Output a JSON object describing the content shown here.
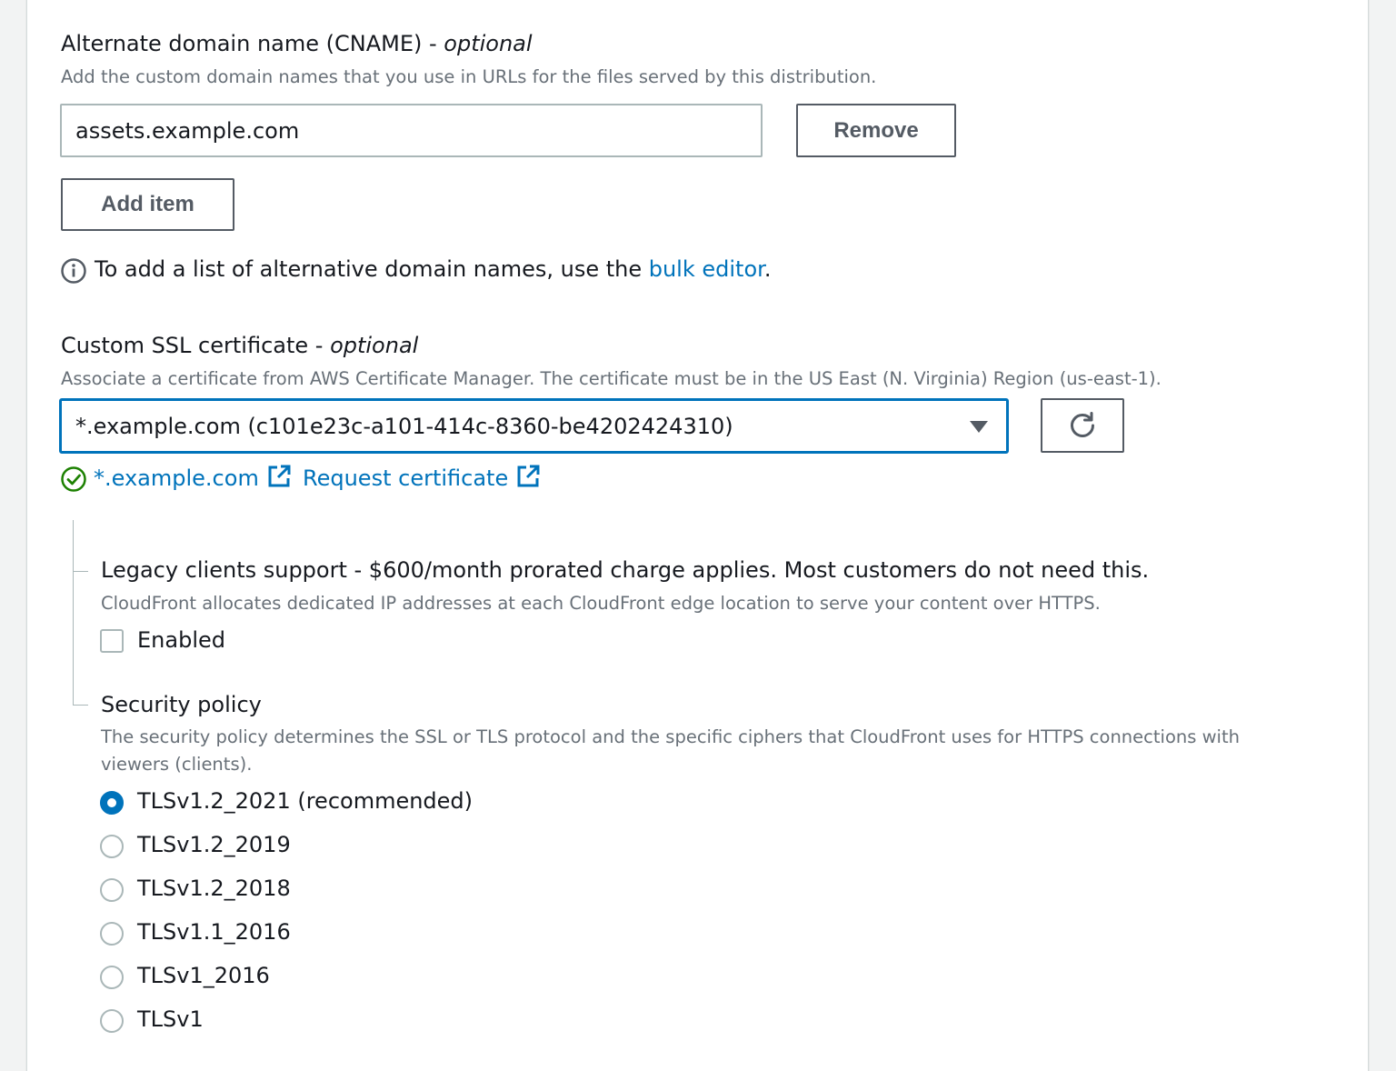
{
  "cname": {
    "label": "Alternate domain name (CNAME) - ",
    "label_optional": "optional",
    "description": "Add the custom domain names that you use in URLs for the files served by this distribution.",
    "value": "assets.example.com",
    "remove_label": "Remove",
    "add_item_label": "Add item",
    "info_text_before": "To add a list of alternative domain names, use the ",
    "info_link": "bulk editor",
    "info_text_after": "."
  },
  "ssl": {
    "label": "Custom SSL certificate - ",
    "label_optional": "optional",
    "description": "Associate a certificate from AWS Certificate Manager. The certificate must be in the US East (N. Virginia) Region (us-east-1).",
    "selected": "*.example.com (c101e23c-a101-414c-8360-be4202424310)",
    "status_link": "*.example.com",
    "request_link": "Request certificate"
  },
  "legacy": {
    "label": "Legacy clients support - $600/month prorated charge applies. Most customers do not need this.",
    "description": "CloudFront allocates dedicated IP addresses at each CloudFront edge location to serve your content over HTTPS.",
    "checkbox_label": "Enabled",
    "checked": false
  },
  "security_policy": {
    "label": "Security policy",
    "description_line1": "The security policy determines the SSL or TLS protocol and the specific ciphers that CloudFront uses for HTTPS connections with",
    "description_line2": "viewers (clients).",
    "options": [
      {
        "label": "TLSv1.2_2021 (recommended)",
        "selected": true
      },
      {
        "label": "TLSv1.2_2019",
        "selected": false
      },
      {
        "label": "TLSv1.2_2018",
        "selected": false
      },
      {
        "label": "TLSv1.1_2016",
        "selected": false
      },
      {
        "label": "TLSv1_2016",
        "selected": false
      },
      {
        "label": "TLSv1",
        "selected": false
      }
    ]
  },
  "colors": {
    "accent": "#0073bb",
    "success": "#1d8102",
    "border": "#aab7b8",
    "text_secondary": "#687078"
  },
  "icons": {
    "info": "info-icon",
    "refresh": "refresh-icon",
    "success": "status-success-icon",
    "external": "external-link-icon"
  }
}
